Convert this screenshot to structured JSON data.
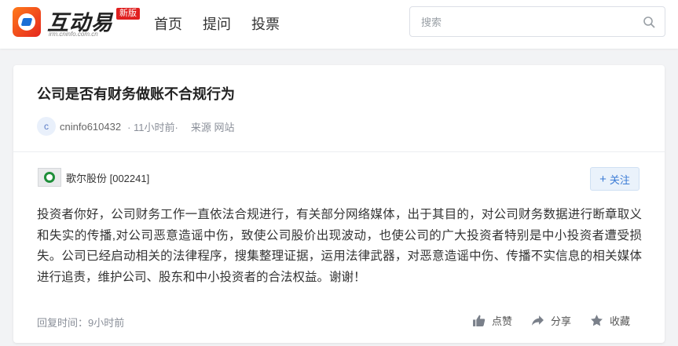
{
  "brand": {
    "name": "互动易",
    "domain": "irm.cninfo.com.cn",
    "badge": "新版",
    "colors": {
      "accent": "#3a7bd5",
      "badge": "#e02020",
      "logo": "#ff7a1a"
    }
  },
  "nav": {
    "items": [
      "首页",
      "提问",
      "投票"
    ]
  },
  "search": {
    "placeholder": "搜索",
    "icon": "search-icon"
  },
  "question": {
    "title": "公司是否有财务做账不合规行为",
    "avatar_letter": "c",
    "user": "cninfo610432",
    "time": "· 11小时前·",
    "source": "来源 网站"
  },
  "answer": {
    "company": "歌尔股份 [002241]",
    "follow_label": "关注",
    "text": "投资者你好，公司财务工作一直依法合规进行，有关部分网络媒体，出于其目的，对公司财务数据进行断章取义和失实的传播,对公司恶意造谣中伤，致使公司股价出现波动，也使公司的广大投资者特别是中小投资者遭受损失。公司已经启动相关的法律程序，搜集整理证据，运用法律武器，对恶意造谣中伤、传播不实信息的相关媒体进行追责，维护公司、股东和中小投资者的合法权益。谢谢！",
    "reply_time": "回复时间：9小时前"
  },
  "actions": {
    "like": "点赞",
    "share": "分享",
    "favorite": "收藏"
  }
}
